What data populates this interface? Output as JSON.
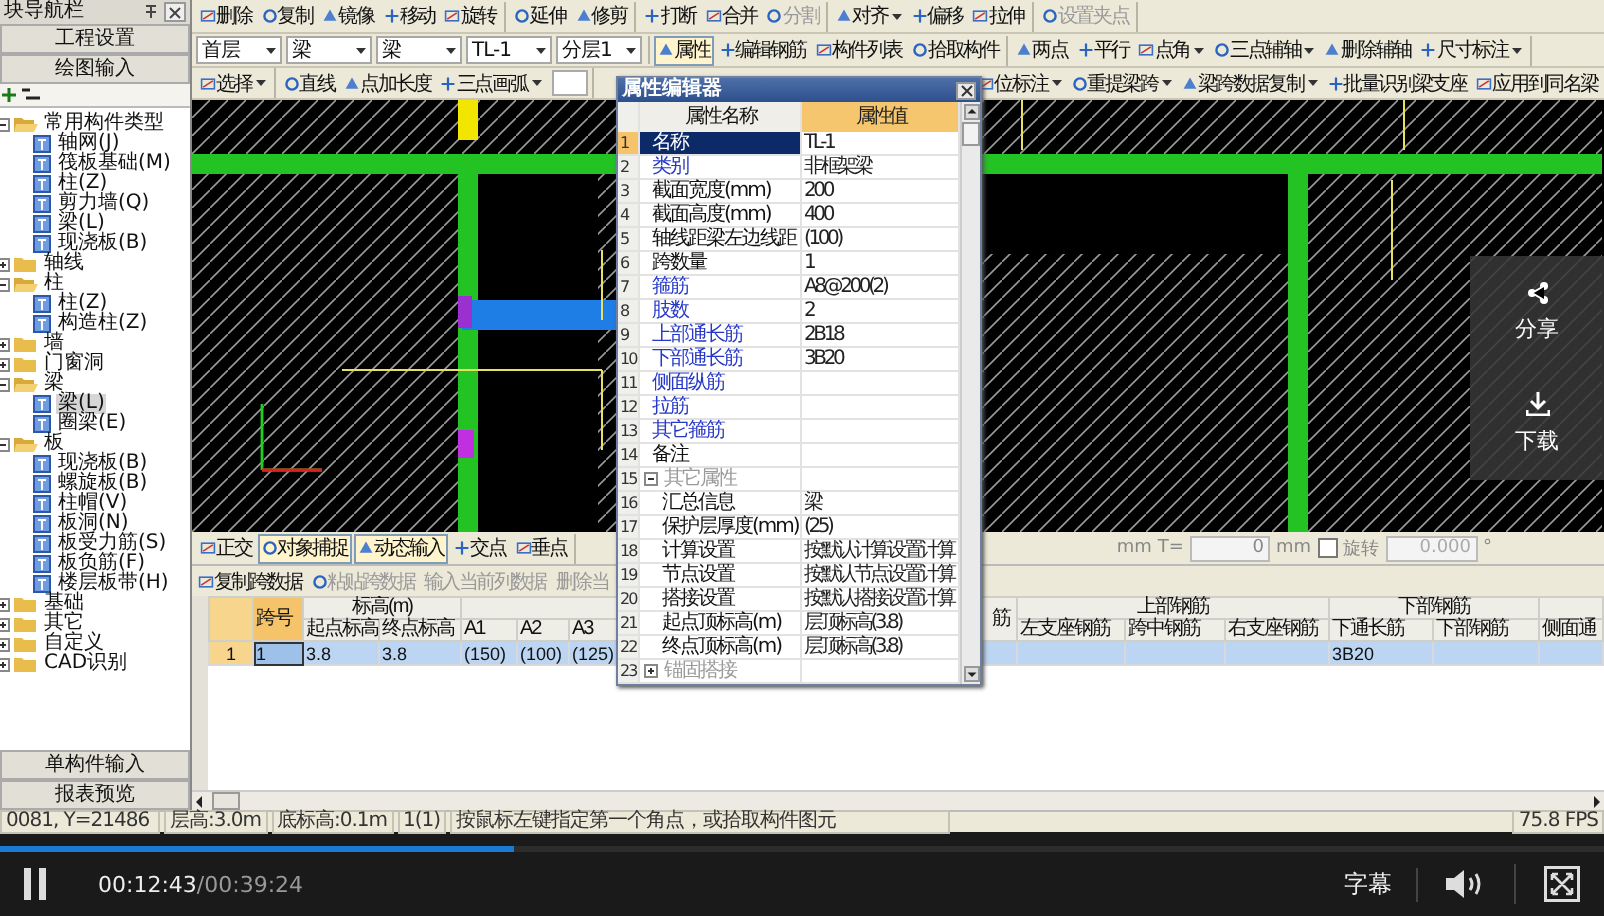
{
  "nav": {
    "title": "块导航栏",
    "buttons": [
      "工程设置",
      "绘图输入"
    ],
    "tree": [
      {
        "label": "常用构件类型",
        "expanded": true,
        "children": [
          {
            "label": "轴网(J)",
            "selected": false
          },
          {
            "label": "筏板基础(M)",
            "selected": false
          },
          {
            "label": "柱(Z)",
            "selected": false
          },
          {
            "label": "剪力墙(Q)",
            "selected": false
          },
          {
            "label": "梁(L)",
            "selected": false
          },
          {
            "label": "现浇板(B)",
            "selected": false
          }
        ]
      },
      {
        "label": "轴线",
        "expanded": false
      },
      {
        "label": "柱",
        "expanded": true,
        "children": [
          {
            "label": "柱(Z)",
            "selected": false
          },
          {
            "label": "构造柱(Z)",
            "selected": false
          }
        ]
      },
      {
        "label": "墙",
        "expanded": false
      },
      {
        "label": "门窗洞",
        "expanded": false
      },
      {
        "label": "梁",
        "expanded": true,
        "children": [
          {
            "label": "梁(L)",
            "selected": true
          },
          {
            "label": "圈梁(E)",
            "selected": false
          }
        ]
      },
      {
        "label": "板",
        "expanded": true,
        "children": [
          {
            "label": "现浇板(B)",
            "selected": false
          },
          {
            "label": "螺旋板(B)",
            "selected": false
          },
          {
            "label": "柱帽(V)",
            "selected": false
          },
          {
            "label": "板洞(N)",
            "selected": false
          },
          {
            "label": "板受力筋(S)",
            "selected": false
          },
          {
            "label": "板负筋(F)",
            "selected": false
          },
          {
            "label": "楼层板带(H)",
            "selected": false
          }
        ]
      },
      {
        "label": "基础",
        "expanded": false
      },
      {
        "label": "其它",
        "expanded": false
      },
      {
        "label": "自定义",
        "expanded": false
      },
      {
        "label": "CAD识别",
        "expanded": false
      }
    ],
    "footer_buttons": [
      "单构件输入",
      "报表预览"
    ]
  },
  "toolbars": [
    [
      [
        {
          "kind": "button",
          "label": "删除",
          "dropdown": false,
          "disabled": false
        },
        {
          "kind": "button",
          "label": "复制",
          "dropdown": false,
          "disabled": false
        },
        {
          "kind": "button",
          "label": "镜像",
          "dropdown": false,
          "disabled": false
        },
        {
          "kind": "button",
          "label": "移动",
          "dropdown": false,
          "disabled": false
        },
        {
          "kind": "button",
          "label": "旋转",
          "dropdown": false,
          "disabled": false
        }
      ],
      [
        {
          "kind": "button",
          "label": "延伸",
          "dropdown": false,
          "disabled": false
        },
        {
          "kind": "button",
          "label": "修剪",
          "dropdown": false,
          "disabled": false
        }
      ],
      [
        {
          "kind": "button",
          "label": "打断",
          "dropdown": false,
          "disabled": false
        },
        {
          "kind": "button",
          "label": "合并",
          "dropdown": false,
          "disabled": false
        },
        {
          "kind": "button",
          "label": "分割",
          "dropdown": false,
          "disabled": true
        }
      ],
      [
        {
          "kind": "button",
          "label": "对齐",
          "dropdown": true,
          "disabled": false
        },
        {
          "kind": "button",
          "label": "偏移",
          "dropdown": false,
          "disabled": false
        },
        {
          "kind": "button",
          "label": "拉伸",
          "dropdown": false,
          "disabled": false
        }
      ],
      [
        {
          "kind": "button",
          "label": "设置夹点",
          "dropdown": false,
          "disabled": true
        }
      ]
    ],
    [
      [
        {
          "kind": "select",
          "value": "首层"
        },
        {
          "kind": "select",
          "value": "梁"
        },
        {
          "kind": "select",
          "value": "梁"
        },
        {
          "kind": "select",
          "value": "TL-1"
        },
        {
          "kind": "select",
          "value": "分层1"
        }
      ],
      [
        {
          "kind": "button",
          "label": "属性",
          "dropdown": false,
          "disabled": false,
          "selected": true
        },
        {
          "kind": "button",
          "label": "编辑钢筋",
          "dropdown": false,
          "disabled": false,
          "selected": false
        },
        {
          "kind": "button",
          "label": "构件列表",
          "dropdown": false,
          "disabled": false,
          "selected": false
        },
        {
          "kind": "button",
          "label": "拾取构件",
          "dropdown": false,
          "disabled": false,
          "selected": false
        }
      ],
      [
        {
          "kind": "button",
          "label": "两点",
          "dropdown": false,
          "disabled": false
        },
        {
          "kind": "button",
          "label": "平行",
          "dropdown": false,
          "disabled": false
        },
        {
          "kind": "button",
          "label": "点角",
          "dropdown": true,
          "disabled": false
        },
        {
          "kind": "button",
          "label": "三点辅轴",
          "dropdown": true,
          "disabled": false
        },
        {
          "kind": "button",
          "label": "删除辅轴",
          "dropdown": false,
          "disabled": false
        },
        {
          "kind": "button",
          "label": "尺寸标注",
          "dropdown": true,
          "disabled": false
        }
      ]
    ],
    [
      [
        {
          "kind": "button",
          "label": "选择",
          "dropdown": true,
          "disabled": false
        }
      ],
      [
        {
          "kind": "button",
          "label": "直线",
          "dropdown": false,
          "disabled": false
        },
        {
          "kind": "button",
          "label": "点加长度",
          "dropdown": false,
          "disabled": false
        },
        {
          "kind": "button",
          "label": "三点画弧",
          "dropdown": true,
          "disabled": false
        },
        {
          "kind": "input"
        }
      ],
      [
        {
          "kind": "button",
          "label": "位标注",
          "dropdown": true,
          "disabled": false
        },
        {
          "kind": "button",
          "label": "重提梁跨",
          "dropdown": true,
          "disabled": false
        },
        {
          "kind": "button",
          "label": "梁跨数据复制",
          "dropdown": true,
          "disabled": false
        },
        {
          "kind": "button",
          "label": "批量识别梁支座",
          "dropdown": false,
          "disabled": false
        },
        {
          "kind": "button",
          "label": "应用到同名梁",
          "dropdown": false,
          "disabled": false
        }
      ]
    ]
  ],
  "snap_bar": {
    "toggles": [
      {
        "label": "正交",
        "on": false
      },
      {
        "label": "对象捕捉",
        "on": true
      },
      {
        "label": "动态输入",
        "on": true
      },
      {
        "label": "交点",
        "on": false
      },
      {
        "label": "垂点",
        "on": false
      }
    ],
    "offset": {
      "unit_1": "mm",
      "t_label": "T=",
      "t_value": "0",
      "unit_2": "mm"
    },
    "rotate": {
      "label": "旋转",
      "checked": false,
      "value": "0.000",
      "unit": "°",
      "disabled": true
    }
  },
  "span_table": {
    "toolbar": [
      {
        "label": "复制跨数据",
        "disabled": false
      },
      {
        "label": "粘贴跨数据",
        "disabled": true
      },
      {
        "label": "输入当前列数据",
        "disabled": true
      },
      {
        "label": "删除当",
        "disabled": true
      }
    ],
    "columns": [
      {
        "label": "跨号",
        "cells": [
          "1"
        ]
      },
      {
        "label": "标高(m)",
        "columns": [
          {
            "label": "起点标高",
            "cells": [
              "3.8"
            ]
          },
          {
            "label": "终点标高",
            "cells": [
              "3.8"
            ]
          }
        ]
      },
      {
        "columns": [
          {
            "label": "A1",
            "cells": [
              "(150)"
            ]
          },
          {
            "label": "A2",
            "cells": [
              "(100)"
            ]
          },
          {
            "label": "A3",
            "cells": [
              "(125)"
            ]
          }
        ]
      },
      {
        "label": "筋"
      },
      {
        "label": "上部钢筋",
        "columns": [
          {
            "label": "左支座钢筋"
          },
          {
            "label": "跨中钢筋"
          },
          {
            "label": "右支座钢筋"
          }
        ]
      },
      {
        "label": "下部钢筋",
        "columns": [
          {
            "label": "下通长筋",
            "cells": [
              "3B20"
            ]
          },
          {
            "label": "下部钢筋"
          }
        ]
      },
      {
        "columns": [
          {
            "label": "侧面通"
          }
        ]
      }
    ],
    "rows": [
      {
        "num": "1",
        "selected": true
      }
    ]
  },
  "property_editor": {
    "title": "属性编辑器",
    "headers": [
      "属性名称",
      "属性值"
    ],
    "rows": [
      {
        "num": "1",
        "name": "名称",
        "value": "TL-1",
        "public": false,
        "selected": true
      },
      {
        "num": "2",
        "name": "类别",
        "value": "非框架梁",
        "public": true,
        "selected": false
      },
      {
        "num": "3",
        "name": "截面宽度(mm)",
        "value": "200",
        "public": false,
        "selected": false
      },
      {
        "num": "4",
        "name": "截面高度(mm)",
        "value": "400",
        "public": false,
        "selected": false
      },
      {
        "num": "5",
        "name": "轴线距梁左边线距",
        "value": "(100)",
        "public": false,
        "selected": false
      },
      {
        "num": "6",
        "name": "跨数量",
        "value": "1",
        "public": false,
        "selected": false
      },
      {
        "num": "7",
        "name": "箍筋",
        "value": "A8@200(2)",
        "public": true,
        "selected": false
      },
      {
        "num": "8",
        "name": "肢数",
        "value": "2",
        "public": true,
        "selected": false
      },
      {
        "num": "9",
        "name": "上部通长筋",
        "value": "2B18",
        "public": true,
        "selected": false
      },
      {
        "num": "10",
        "name": "下部通长筋",
        "value": "3B20",
        "public": true,
        "selected": false
      },
      {
        "num": "11",
        "name": "侧面纵筋",
        "public": true,
        "selected": false
      },
      {
        "num": "12",
        "name": "拉筋",
        "public": true,
        "selected": false
      },
      {
        "num": "13",
        "name": "其它箍筋",
        "public": true,
        "selected": false
      },
      {
        "num": "14",
        "name": "备注",
        "public": false,
        "selected": false
      },
      {
        "num": "15",
        "name": "其它属性",
        "expanded": true,
        "children": [
          {
            "num": "16",
            "name": "汇总信息",
            "value": "梁",
            "public": false,
            "selected": false
          },
          {
            "num": "17",
            "name": "保护层厚度(mm)",
            "value": "(25)",
            "public": false,
            "selected": false
          },
          {
            "num": "18",
            "name": "计算设置",
            "value": "按默认计算设置计算",
            "public": false,
            "selected": false
          },
          {
            "num": "19",
            "name": "节点设置",
            "value": "按默认节点设置计算",
            "public": false,
            "selected": false
          },
          {
            "num": "20",
            "name": "搭接设置",
            "value": "按默认搭接设置计算",
            "public": false,
            "selected": false
          },
          {
            "num": "21",
            "name": "起点顶标高(m)",
            "value": "层顶标高(3.8)",
            "public": false,
            "selected": false
          },
          {
            "num": "22",
            "name": "终点顶标高(m)",
            "value": "层顶标高(3.8)",
            "public": false,
            "selected": false
          }
        ]
      },
      {
        "num": "23",
        "name": "锚固搭接",
        "expanded": false
      }
    ]
  },
  "status_bar": [
    "0081, Y=21486",
    "层高:3.0m",
    "底标高:0.1m",
    "1(1)",
    "按鼠标左键指定第一个角点，或拾取构件图元",
    "75.8 FPS"
  ],
  "share_panel": {
    "buttons": [
      "分享",
      "下载"
    ]
  },
  "video_player": {
    "playing": true,
    "current_time": "00:12:43",
    "duration": "/00:39:24",
    "level": 0.32,
    "subtitles": "字幕"
  }
}
